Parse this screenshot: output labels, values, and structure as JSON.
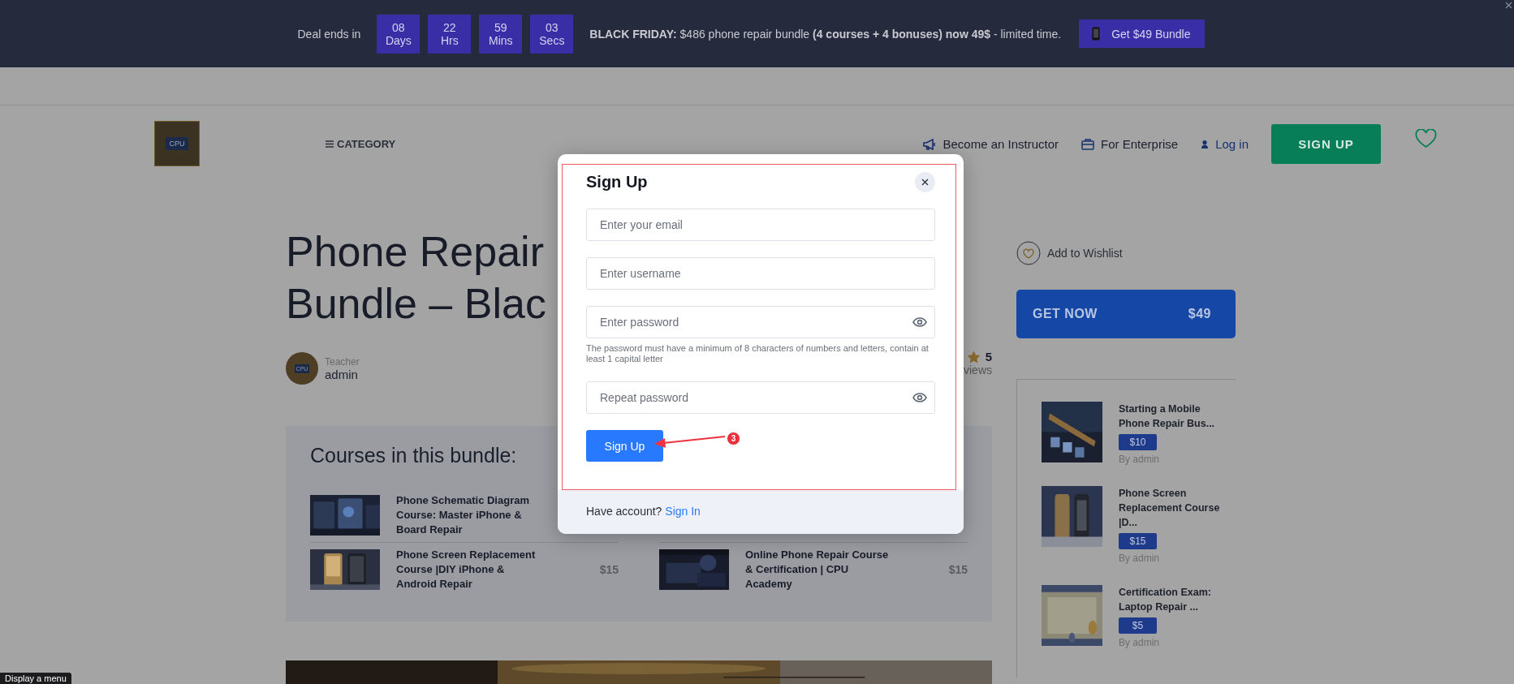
{
  "banner": {
    "label": "Deal ends in",
    "countdown": [
      {
        "value": "08",
        "unit": "Days"
      },
      {
        "value": "22",
        "unit": "Hrs"
      },
      {
        "value": "59",
        "unit": "Mins"
      },
      {
        "value": "03",
        "unit": "Secs"
      }
    ],
    "promo": "**BLACK FRIDAY:** $486 phone repair bundle **(4 courses + 4 bonuses) now 49$** - limited time.",
    "button": "Get $49 Bundle"
  },
  "header": {
    "logo_text": "CPU",
    "menu": "CATEGORY",
    "links": [
      {
        "kind": "megaphone",
        "label": "Become an Instructor"
      },
      {
        "kind": "briefcase",
        "label": "For Enterprise"
      },
      {
        "kind": "user",
        "label": "Log in"
      }
    ],
    "signup": "SIGN UP"
  },
  "course": {
    "title_lines": [
      "Phone Repair",
      "Bundle – Blac"
    ],
    "teacher_label": "Teacher",
    "teacher": "admin",
    "avatar_text": "CPU",
    "rating": "5",
    "reviews": "views"
  },
  "bundle": {
    "heading": "Courses in this bundle:",
    "courses": [
      {
        "title": "Phone Schematic Diagram Course: Master iPhone & Board Repair"
      },
      {
        "title": "Phone Screen Replacement Course |DIY iPhone & Android Repair",
        "price": "$15"
      },
      {
        "title": "Online Phone Repair Course & Certification | CPU Academy",
        "price": "$15"
      }
    ]
  },
  "sidebar": {
    "wishlist": "Add to Wishlist",
    "get_now": "GET NOW",
    "price": "$49",
    "courses": [
      {
        "title": "Starting a Mobile Phone Repair Bus...",
        "price": "$10",
        "author": "By admin"
      },
      {
        "title": "Phone Screen Replacement Course |D...",
        "price": "$15",
        "author": "By admin"
      },
      {
        "title": "Certification Exam: Laptop Repair ...",
        "price": "$5",
        "author": "By admin"
      }
    ]
  },
  "modal": {
    "title": "Sign Up",
    "fields": [
      {
        "placeholder": "Enter your email",
        "reveal": false
      },
      {
        "placeholder": "Enter username",
        "reveal": false
      },
      {
        "placeholder": "Enter password",
        "reveal": true,
        "hint": "The password must have a minimum of 8 characters of numbers and letters, contain at least 1 capital letter"
      },
      {
        "placeholder": "Repeat password",
        "reveal": true
      }
    ],
    "button": "Sign Up",
    "footer": "Have account?",
    "footer_link": "Sign In"
  },
  "annotation": {
    "number": "3"
  },
  "tooltip": "Display a menu"
}
